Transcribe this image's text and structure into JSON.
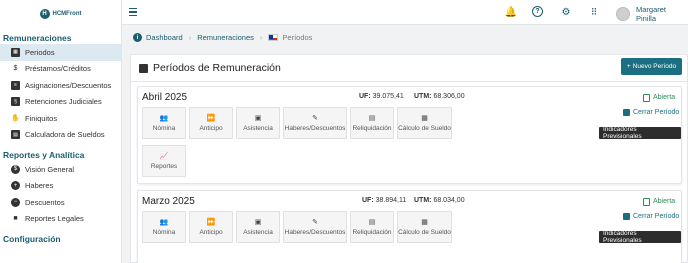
{
  "app": {
    "logo_text": "HCMFront"
  },
  "sidebar": {
    "sections": [
      {
        "title": "Remuneraciones"
      },
      {
        "title": "Reportes y Analítica"
      },
      {
        "title": "Configuración"
      }
    ],
    "items": [
      {
        "label": "Periodos",
        "icon": "calendar-icon",
        "active": true
      },
      {
        "label": "Préstamos/Créditos",
        "icon": "dollar-icon"
      },
      {
        "label": "Asignaciones/Descuentos",
        "icon": "tag-icon"
      },
      {
        "label": "Retenciones Judiciales",
        "icon": "file-icon"
      },
      {
        "label": "Finiquitos",
        "icon": "handshake-icon"
      },
      {
        "label": "Calculadora de Sueldos",
        "icon": "calculator-icon"
      },
      {
        "label": "Visión General",
        "icon": "dollar-circle-icon"
      },
      {
        "label": "Haberes",
        "icon": "plus-circle-icon"
      },
      {
        "label": "Descuentos",
        "icon": "minus-circle-icon"
      },
      {
        "label": "Reportes Legales",
        "icon": "folder-icon"
      }
    ]
  },
  "header": {
    "user_name": "Margaret Pinilla"
  },
  "breadcrumb": {
    "items": [
      "Dashboard",
      "Remuneraciones",
      "Períodos"
    ]
  },
  "main": {
    "title": "Períodos de Remuneración",
    "new_button": "Nuevo Período"
  },
  "periods": [
    {
      "name": "Abril 2025",
      "uf_label": "UF:",
      "uf": "39.075,41",
      "utm_label": "UTM:",
      "utm": "68.306,00",
      "status": "Abierta",
      "close_label": "Cerrar Período",
      "indicators_label": "Indicadores Previsionales"
    },
    {
      "name": "Marzo 2025",
      "uf_label": "UF:",
      "uf": "38.894,11",
      "utm_label": "UTM:",
      "utm": "68.034,00",
      "status": "Abierta",
      "close_label": "Cerrar Período",
      "indicators_label": "Indicadores Previsionales"
    }
  ],
  "tiles": [
    "Nómina",
    "Anticipo",
    "Asistencia",
    "Haberes/Descuentos",
    "Reliquidación",
    "Cálculo de Sueldo",
    "Reportes"
  ],
  "colors": {
    "accent": "#1c6f82",
    "status_open": "#2e8b57",
    "dark_badge": "#2d2d2d"
  }
}
